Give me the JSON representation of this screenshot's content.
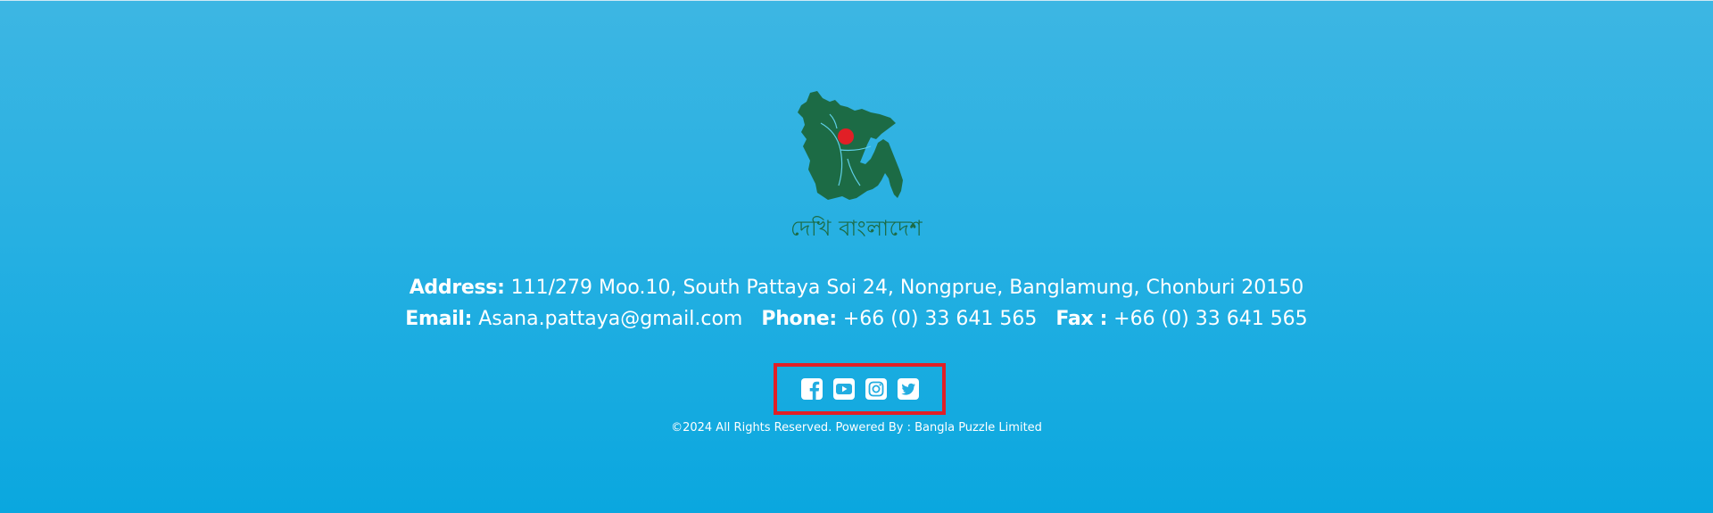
{
  "footer": {
    "logo": {
      "alt": "দেখি বাংলাদেশ",
      "text": "দেখি বাংলাদেশ",
      "map_color": "#1c6b45",
      "marker_color": "#e11f26"
    },
    "address": {
      "label": "Address:",
      "value": "111/279 Moo.10, South Pattaya Soi 24, Nongprue, Banglamung, Chonburi 20150"
    },
    "email": {
      "label": "Email:",
      "value": "Asana.pattaya@gmail.com"
    },
    "phone": {
      "label": "Phone:",
      "value": "+66 (0) 33 641 565"
    },
    "fax": {
      "label": "Fax :",
      "value": "+66 (0) 33 641 565"
    },
    "social": [
      {
        "icon": "facebook-icon"
      },
      {
        "icon": "youtube-icon"
      },
      {
        "icon": "instagram-icon"
      },
      {
        "icon": "twitter-icon"
      }
    ],
    "highlight_color": "#e11f26",
    "copyright": "©2024 All Rights Reserved. Powered By : Bangla Puzzle Limited"
  }
}
